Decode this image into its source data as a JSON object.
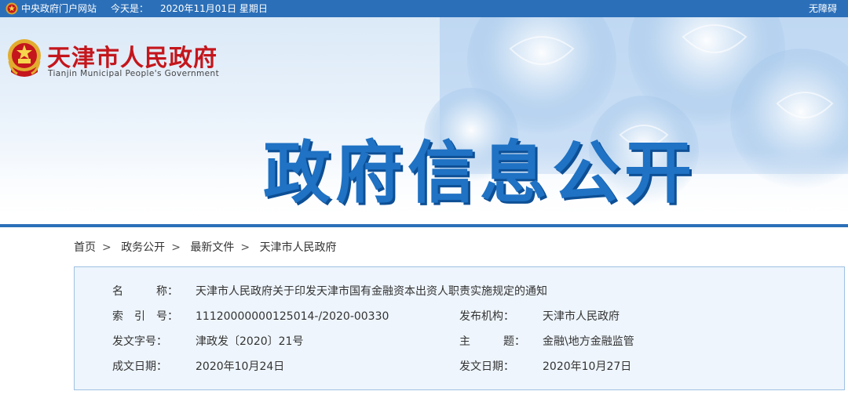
{
  "topbar": {
    "portal_link": "中央政府门户网站",
    "today_label": "今天是：",
    "date": "2020年11月01日 星期日",
    "accessibility": "无障碍"
  },
  "banner": {
    "site_name_cn": "天津市人民政府",
    "site_name_en": "Tianjin Municipal People's Government",
    "headline": "政府信息公开"
  },
  "breadcrumb": {
    "items": [
      "首页",
      "政务公开",
      "最新文件",
      "天津市人民政府"
    ],
    "separator": ">"
  },
  "info": {
    "name_label": "名　　　称：",
    "name_value": "天津市人民政府关于印发天津市国有金融资本出资人职责实施规定的通知",
    "index_label": "索　引　号：",
    "index_value": "11120000000125014-/2020-00330",
    "publisher_label": "发布机构：",
    "publisher_value": "天津市人民政府",
    "doc_no_label": "发文字号：",
    "doc_no_value": "津政发〔2020〕21号",
    "topic_label": "主　　　题：",
    "topic_value": "金融\\地方金融监管",
    "written_label": "成文日期：",
    "written_value": "2020年10月24日",
    "issued_label": "发文日期：",
    "issued_value": "2020年10月27日"
  },
  "colors": {
    "topbar_bg": "#2b6fb8",
    "site_name": "#c4161c",
    "headline": "#1f72c4",
    "info_bg": "#eef5fc",
    "info_border": "#9ec1e3"
  },
  "icons": [
    "national-emblem-icon",
    "tianjin-emblem-icon"
  ]
}
